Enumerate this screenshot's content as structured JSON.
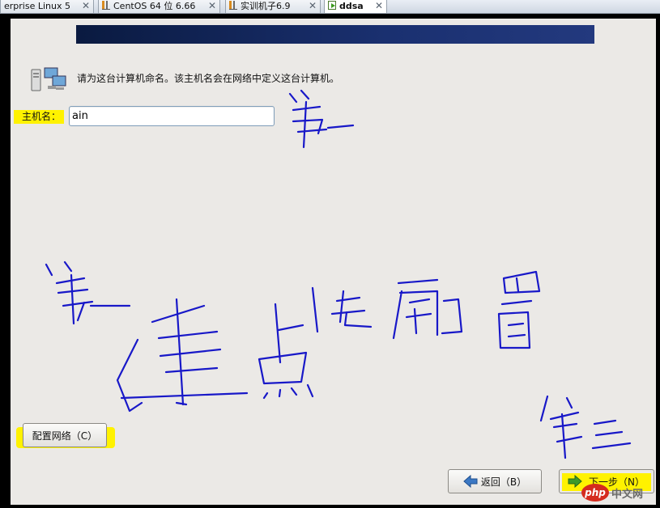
{
  "vm_tabs": [
    {
      "label": "erprise Linux 5",
      "active": false
    },
    {
      "label": "CentOS 64 位 6.66",
      "active": false
    },
    {
      "label": "实训机子6.9",
      "active": false
    },
    {
      "label": "ddsa",
      "active": true
    }
  ],
  "tab_close_glyph": "✕",
  "installer": {
    "instruction": "请为这台计算机命名。该主机名会在网络中定义这台计算机。",
    "hostname_label": "主机名：",
    "hostname_value": "ain",
    "configure_network_button": "配置网络（C）",
    "back_button": "返回（B）",
    "next_button": "下一步（N）"
  },
  "watermark": {
    "logo": "php",
    "text": "中文网"
  },
  "colors": {
    "highlight": "#fff200",
    "annotation_ink": "#1818c8",
    "banner": "#1a3070"
  }
}
